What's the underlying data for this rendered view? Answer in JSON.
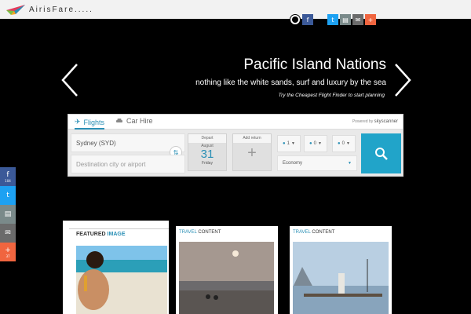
{
  "header": {
    "logo_text": "AirisFare.....",
    "social": [
      "github-icon",
      "facebook-icon",
      "twitter-icon",
      "print-icon",
      "email-icon",
      "plus-icon"
    ]
  },
  "slider": {
    "title": "Pacific Island Nations",
    "subtitle": "nothing like the white sands, surf and luxury by the sea",
    "cta": "Try the Cheapest Flight Finder to start planning"
  },
  "flight_widget": {
    "tabs": [
      {
        "label": "Flights",
        "icon": "plane-icon"
      },
      {
        "label": "Car Hire",
        "icon": "car-icon"
      }
    ],
    "powered_by": "Powered by",
    "powered_brand": "skyscanner",
    "origin": "Sydney (SYD)",
    "destination_placeholder": "Destination city or airport",
    "depart": {
      "label": "Depart",
      "month": "August",
      "day": "31",
      "weekday": "Friday"
    },
    "add_return_label": "Add return",
    "passengers": {
      "adults": "1",
      "children": "0",
      "infants": "0"
    },
    "cabin_class": "Economy"
  },
  "side_share": [
    {
      "icon": "facebook-icon",
      "count": "104",
      "color": "#3b5998"
    },
    {
      "icon": "twitter-icon",
      "count": "",
      "color": "#1da1f2"
    },
    {
      "icon": "print-icon",
      "count": "",
      "color": "#7a8a8a"
    },
    {
      "icon": "email-icon",
      "count": "",
      "color": "#6b6b6b"
    },
    {
      "icon": "plus-icon",
      "count": "37",
      "color": "#f0653f"
    }
  ],
  "cards": {
    "featured": {
      "label_a": "FEATURED",
      "label_b": "IMAGE"
    },
    "travel1": {
      "label_a": "TRAVEL",
      "label_b": "CONTENT"
    },
    "travel2": {
      "label_a": "TRAVEL",
      "label_b": "CONTENT"
    }
  },
  "colors": {
    "accent": "#2a8fb5",
    "search_button": "#21a4c9"
  }
}
